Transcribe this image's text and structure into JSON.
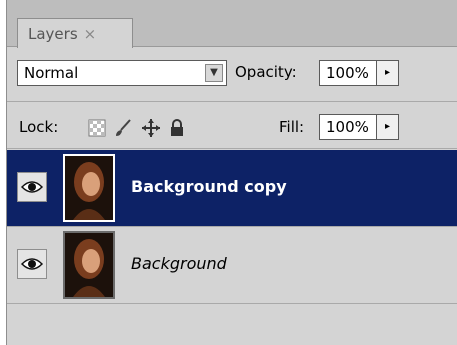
{
  "tabs": [
    {
      "label": "Layers",
      "close": "×"
    }
  ],
  "blend_mode": {
    "value": "Normal",
    "arrow": "▼"
  },
  "opacity": {
    "label": "Opacity:",
    "value": "100%",
    "arrow": "▸"
  },
  "lock": {
    "label": "Lock:",
    "icons": [
      "transparency-lock-icon",
      "brush-lock-icon",
      "move-lock-icon",
      "padlock-icon"
    ]
  },
  "fill": {
    "label": "Fill:",
    "value": "100%",
    "arrow": "▸"
  },
  "layers": [
    {
      "name": "Background copy",
      "visible": true,
      "selected": true
    },
    {
      "name": "Background",
      "visible": true,
      "selected": false
    }
  ],
  "colors": {
    "selected_row": "#0d2266",
    "panel_bg": "#d4d4d4"
  }
}
